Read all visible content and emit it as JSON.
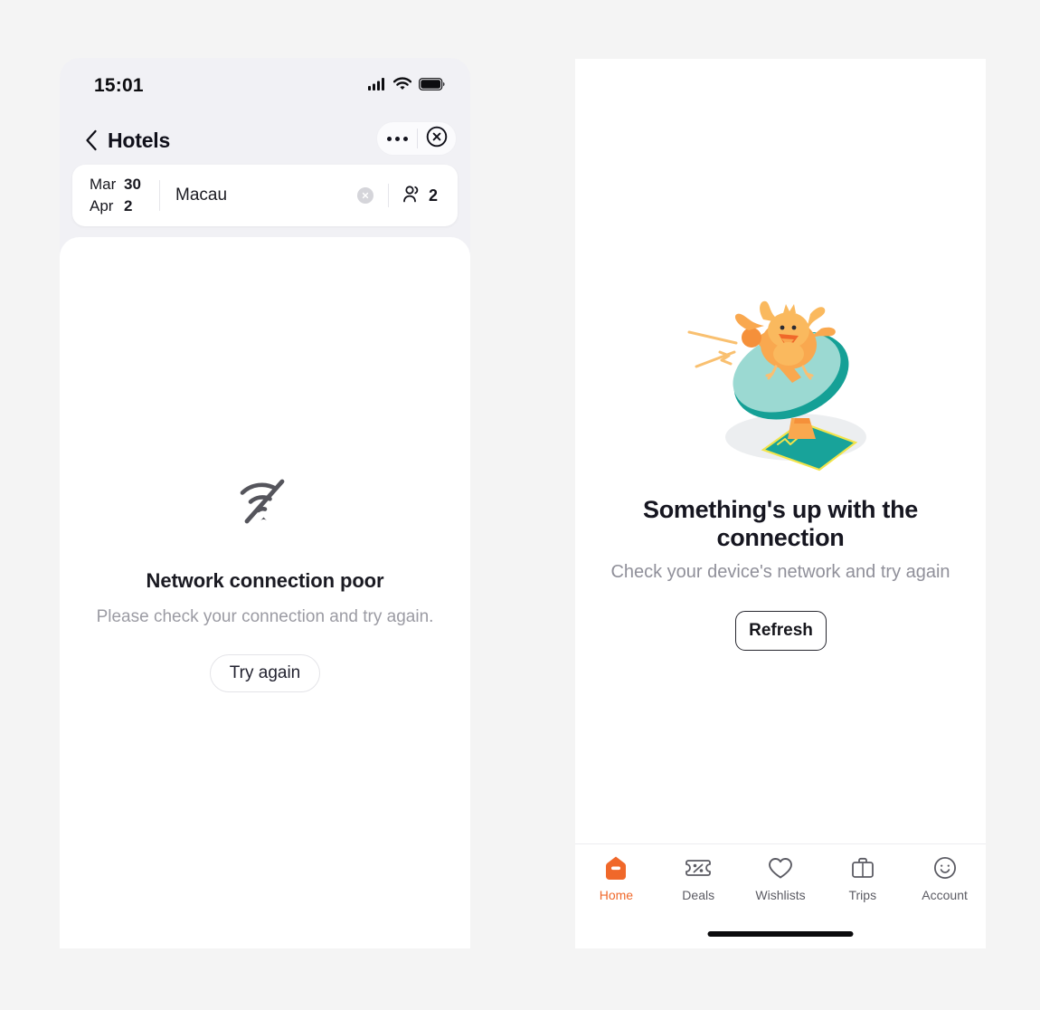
{
  "colors": {
    "page_bg": "#f4f4f4",
    "phone_bg": "#f1f1f5",
    "accent_orange": "#f0682a",
    "muted_text": "#9b9ba3",
    "dish_light": "#9ad9d4",
    "dish_dark": "#1a9e96",
    "bird_orange": "#f9a84f"
  },
  "left_phone": {
    "status_bar": {
      "time": "15:01",
      "icons": [
        "cellular-signal-icon",
        "wifi-icon",
        "battery-icon"
      ]
    },
    "nav": {
      "back_icon": "chevron-left-icon",
      "title": "Hotels",
      "more_icon": "more-dots-icon",
      "close_icon": "close-circle-icon"
    },
    "search": {
      "date_from_month": "Mar",
      "date_from_day": "30",
      "date_to_month": "Apr",
      "date_to_day": "2",
      "destination": "Macau",
      "clear_icon": "clear-circle-icon",
      "guests_icon": "guests-icon",
      "guests_count": "2"
    },
    "error": {
      "icon": "wifi-off-icon",
      "title": "Network connection poor",
      "subtitle": "Please check your connection and try again.",
      "button_label": "Try again"
    }
  },
  "right_phone": {
    "illustration": "bird-on-satellite-dish-illustration",
    "error": {
      "title": "Something's up with the connection",
      "subtitle": "Check your device's network and try again",
      "button_label": "Refresh"
    },
    "tabs": [
      {
        "label": "Home",
        "icon": "home-icon",
        "active": true
      },
      {
        "label": "Deals",
        "icon": "deals-ticket-icon",
        "active": false
      },
      {
        "label": "Wishlists",
        "icon": "heart-icon",
        "active": false
      },
      {
        "label": "Trips",
        "icon": "briefcase-icon",
        "active": false
      },
      {
        "label": "Account",
        "icon": "smiley-face-icon",
        "active": false
      }
    ],
    "home_indicator": "home-indicator-bar"
  }
}
